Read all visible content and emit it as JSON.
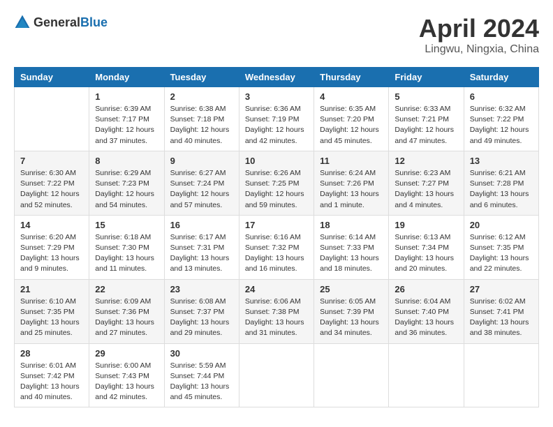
{
  "header": {
    "logo_general": "General",
    "logo_blue": "Blue",
    "month": "April 2024",
    "location": "Lingwu, Ningxia, China"
  },
  "weekdays": [
    "Sunday",
    "Monday",
    "Tuesday",
    "Wednesday",
    "Thursday",
    "Friday",
    "Saturday"
  ],
  "weeks": [
    [
      {
        "day": "",
        "info": ""
      },
      {
        "day": "1",
        "info": "Sunrise: 6:39 AM\nSunset: 7:17 PM\nDaylight: 12 hours\nand 37 minutes."
      },
      {
        "day": "2",
        "info": "Sunrise: 6:38 AM\nSunset: 7:18 PM\nDaylight: 12 hours\nand 40 minutes."
      },
      {
        "day": "3",
        "info": "Sunrise: 6:36 AM\nSunset: 7:19 PM\nDaylight: 12 hours\nand 42 minutes."
      },
      {
        "day": "4",
        "info": "Sunrise: 6:35 AM\nSunset: 7:20 PM\nDaylight: 12 hours\nand 45 minutes."
      },
      {
        "day": "5",
        "info": "Sunrise: 6:33 AM\nSunset: 7:21 PM\nDaylight: 12 hours\nand 47 minutes."
      },
      {
        "day": "6",
        "info": "Sunrise: 6:32 AM\nSunset: 7:22 PM\nDaylight: 12 hours\nand 49 minutes."
      }
    ],
    [
      {
        "day": "7",
        "info": "Sunrise: 6:30 AM\nSunset: 7:22 PM\nDaylight: 12 hours\nand 52 minutes."
      },
      {
        "day": "8",
        "info": "Sunrise: 6:29 AM\nSunset: 7:23 PM\nDaylight: 12 hours\nand 54 minutes."
      },
      {
        "day": "9",
        "info": "Sunrise: 6:27 AM\nSunset: 7:24 PM\nDaylight: 12 hours\nand 57 minutes."
      },
      {
        "day": "10",
        "info": "Sunrise: 6:26 AM\nSunset: 7:25 PM\nDaylight: 12 hours\nand 59 minutes."
      },
      {
        "day": "11",
        "info": "Sunrise: 6:24 AM\nSunset: 7:26 PM\nDaylight: 13 hours\nand 1 minute."
      },
      {
        "day": "12",
        "info": "Sunrise: 6:23 AM\nSunset: 7:27 PM\nDaylight: 13 hours\nand 4 minutes."
      },
      {
        "day": "13",
        "info": "Sunrise: 6:21 AM\nSunset: 7:28 PM\nDaylight: 13 hours\nand 6 minutes."
      }
    ],
    [
      {
        "day": "14",
        "info": "Sunrise: 6:20 AM\nSunset: 7:29 PM\nDaylight: 13 hours\nand 9 minutes."
      },
      {
        "day": "15",
        "info": "Sunrise: 6:18 AM\nSunset: 7:30 PM\nDaylight: 13 hours\nand 11 minutes."
      },
      {
        "day": "16",
        "info": "Sunrise: 6:17 AM\nSunset: 7:31 PM\nDaylight: 13 hours\nand 13 minutes."
      },
      {
        "day": "17",
        "info": "Sunrise: 6:16 AM\nSunset: 7:32 PM\nDaylight: 13 hours\nand 16 minutes."
      },
      {
        "day": "18",
        "info": "Sunrise: 6:14 AM\nSunset: 7:33 PM\nDaylight: 13 hours\nand 18 minutes."
      },
      {
        "day": "19",
        "info": "Sunrise: 6:13 AM\nSunset: 7:34 PM\nDaylight: 13 hours\nand 20 minutes."
      },
      {
        "day": "20",
        "info": "Sunrise: 6:12 AM\nSunset: 7:35 PM\nDaylight: 13 hours\nand 22 minutes."
      }
    ],
    [
      {
        "day": "21",
        "info": "Sunrise: 6:10 AM\nSunset: 7:35 PM\nDaylight: 13 hours\nand 25 minutes."
      },
      {
        "day": "22",
        "info": "Sunrise: 6:09 AM\nSunset: 7:36 PM\nDaylight: 13 hours\nand 27 minutes."
      },
      {
        "day": "23",
        "info": "Sunrise: 6:08 AM\nSunset: 7:37 PM\nDaylight: 13 hours\nand 29 minutes."
      },
      {
        "day": "24",
        "info": "Sunrise: 6:06 AM\nSunset: 7:38 PM\nDaylight: 13 hours\nand 31 minutes."
      },
      {
        "day": "25",
        "info": "Sunrise: 6:05 AM\nSunset: 7:39 PM\nDaylight: 13 hours\nand 34 minutes."
      },
      {
        "day": "26",
        "info": "Sunrise: 6:04 AM\nSunset: 7:40 PM\nDaylight: 13 hours\nand 36 minutes."
      },
      {
        "day": "27",
        "info": "Sunrise: 6:02 AM\nSunset: 7:41 PM\nDaylight: 13 hours\nand 38 minutes."
      }
    ],
    [
      {
        "day": "28",
        "info": "Sunrise: 6:01 AM\nSunset: 7:42 PM\nDaylight: 13 hours\nand 40 minutes."
      },
      {
        "day": "29",
        "info": "Sunrise: 6:00 AM\nSunset: 7:43 PM\nDaylight: 13 hours\nand 42 minutes."
      },
      {
        "day": "30",
        "info": "Sunrise: 5:59 AM\nSunset: 7:44 PM\nDaylight: 13 hours\nand 45 minutes."
      },
      {
        "day": "",
        "info": ""
      },
      {
        "day": "",
        "info": ""
      },
      {
        "day": "",
        "info": ""
      },
      {
        "day": "",
        "info": ""
      }
    ]
  ]
}
